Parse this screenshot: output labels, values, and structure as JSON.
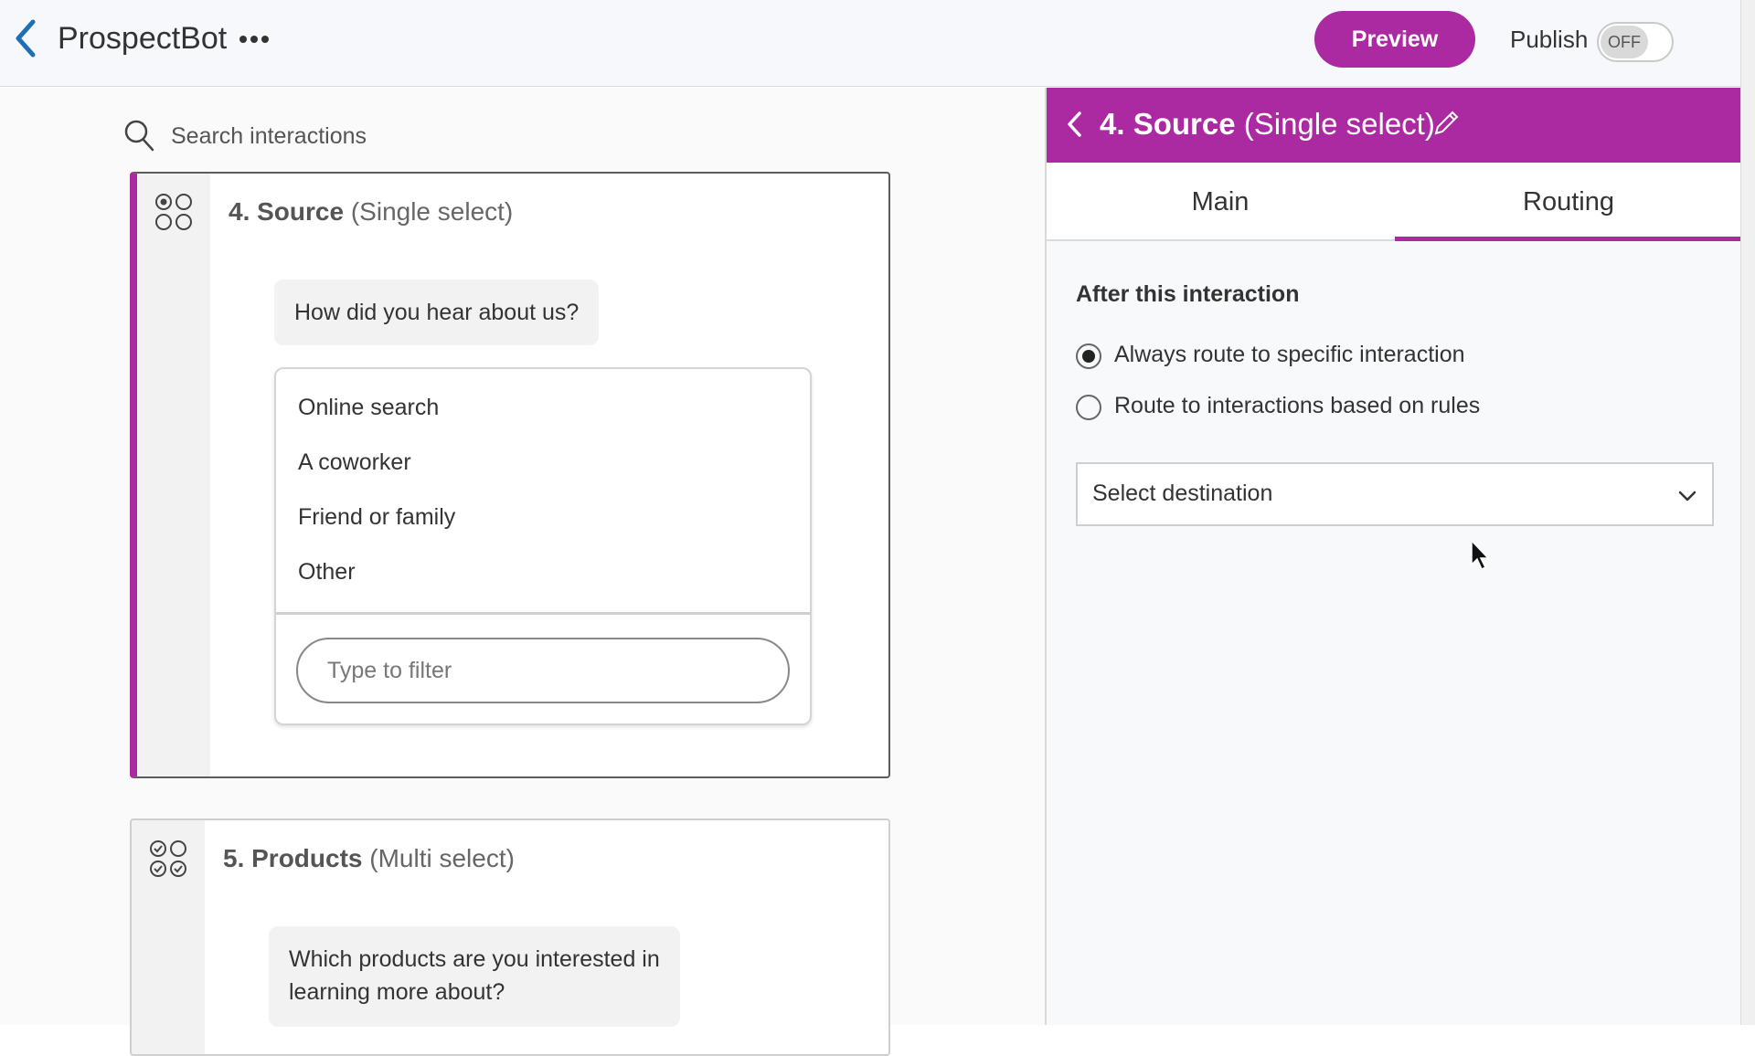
{
  "header": {
    "title": "ProspectBot",
    "preview_label": "Preview",
    "publish_label": "Publish",
    "publish_state": "OFF"
  },
  "search": {
    "placeholder": "Search interactions"
  },
  "interactions": [
    {
      "number_name": "4. Source",
      "kind": "(Single select)",
      "question": "How did you hear about us?",
      "options": [
        "Online search",
        "A coworker",
        "Friend or family",
        "Other"
      ],
      "filter_placeholder": "Type to filter"
    },
    {
      "number_name": "5. Products",
      "kind": "(Multi select)",
      "question_line1": "Which products are you interested in",
      "question_line2": "learning more about?"
    }
  ],
  "panel": {
    "title_name": "4. Source",
    "title_kind": "(Single select)",
    "tabs": [
      "Main",
      "Routing"
    ],
    "selected_tab": "Routing",
    "section_label": "After this interaction",
    "radios": [
      {
        "label": "Always route to specific interaction",
        "checked": true
      },
      {
        "label": "Route to interactions based on rules",
        "checked": false
      }
    ],
    "destination_placeholder": "Select destination"
  },
  "colors": {
    "accent": "#ab2aa1",
    "back_arrow": "#1f6fb5"
  }
}
